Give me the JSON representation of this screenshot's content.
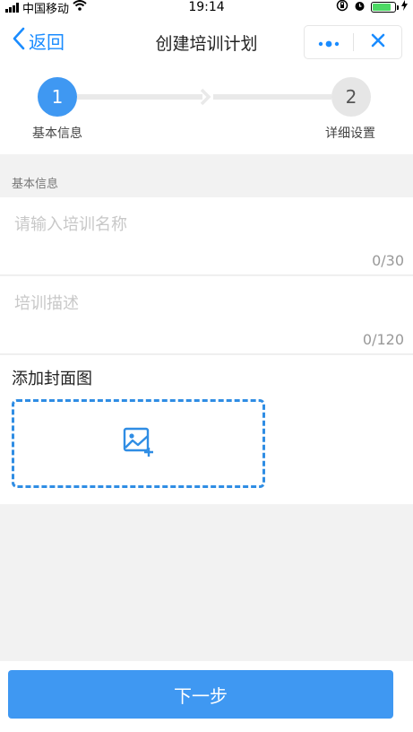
{
  "status_bar": {
    "carrier": "中国移动",
    "time": "19:14",
    "battery_level": 0.85,
    "icons": [
      "signal-icon",
      "wifi-icon",
      "orientation-lock-icon",
      "alarm-icon",
      "battery-icon",
      "charging-icon"
    ]
  },
  "nav": {
    "back_label": "返回",
    "title": "创建培训计划",
    "icons": [
      "chevron-left-icon",
      "more-dots-icon",
      "close-icon"
    ]
  },
  "steps": [
    {
      "number": "1",
      "label": "基本信息",
      "active": true
    },
    {
      "number": "2",
      "label": "详细设置",
      "active": false
    }
  ],
  "section": {
    "title": "基本信息"
  },
  "form": {
    "name_placeholder": "请输入培训名称",
    "name_counter": "0/30",
    "desc_placeholder": "培训描述",
    "desc_counter": "0/120",
    "cover_label": "添加封面图"
  },
  "footer": {
    "next_label": "下一步"
  },
  "colors": {
    "accent": "#3f98f2",
    "link": "#1a8cff",
    "inactive_step": "#e6e6e6",
    "background": "#f2f2f2"
  }
}
